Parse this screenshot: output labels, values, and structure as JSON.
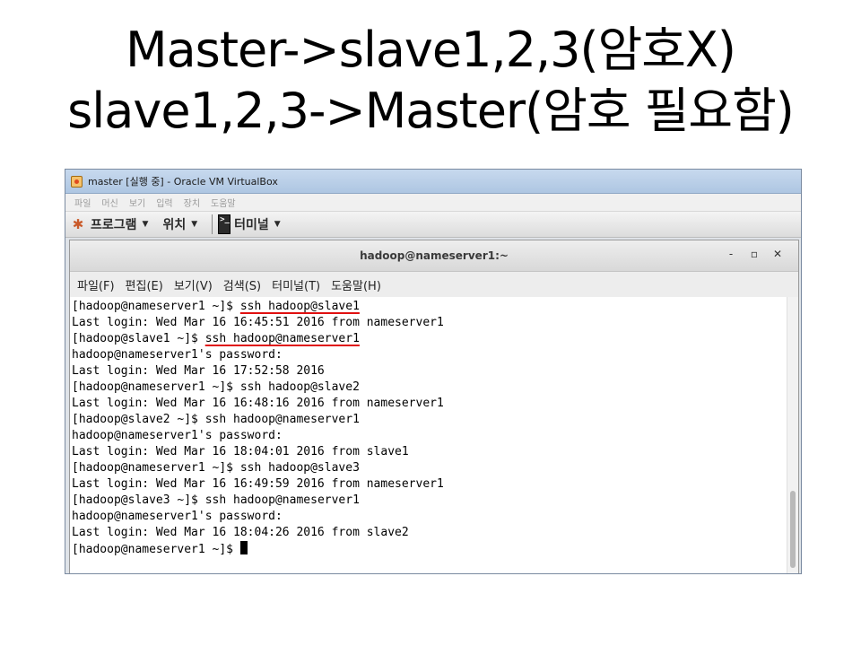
{
  "slide": {
    "title_line1": "Master->slave1,2,3(암호X)",
    "title_line2": "slave1,2,3->Master(암호 필요함)"
  },
  "vbox": {
    "window_title": "master [실행 중] - Oracle VM VirtualBox",
    "menu": [
      "파일",
      "머신",
      "보기",
      "입력",
      "장치",
      "도움말"
    ]
  },
  "guest_panel": {
    "applications": "프로그램",
    "places": "위치",
    "terminal": "터미널"
  },
  "terminal_window": {
    "title": "hadoop@nameserver1:~",
    "controls": {
      "minimize": "-",
      "maximize": "▫",
      "close": "✕"
    },
    "menu": [
      "파일(F)",
      "편집(E)",
      "보기(V)",
      "검색(S)",
      "터미널(T)",
      "도움말(H)"
    ],
    "lines": [
      {
        "prompt": "[hadoop@nameserver1 ~]$ ",
        "command": "ssh hadoop@slave1",
        "underlined": true
      },
      {
        "text": "Last login: Wed Mar 16 16:45:51 2016 from nameserver1"
      },
      {
        "prompt": "[hadoop@slave1 ~]$ ",
        "command": "ssh hadoop@nameserver1",
        "underlined": true
      },
      {
        "text": "hadoop@nameserver1's password:"
      },
      {
        "text": "Last login: Wed Mar 16 17:52:58 2016"
      },
      {
        "prompt": "[hadoop@nameserver1 ~]$ ",
        "command": "ssh hadoop@slave2"
      },
      {
        "text": "Last login: Wed Mar 16 16:48:16 2016 from nameserver1"
      },
      {
        "prompt": "[hadoop@slave2 ~]$ ",
        "command": "ssh hadoop@nameserver1"
      },
      {
        "text": "hadoop@nameserver1's password:"
      },
      {
        "text": "Last login: Wed Mar 16 18:04:01 2016 from slave1"
      },
      {
        "prompt": "[hadoop@nameserver1 ~]$ ",
        "command": "ssh hadoop@slave3"
      },
      {
        "text": "Last login: Wed Mar 16 16:49:59 2016 from nameserver1"
      },
      {
        "prompt": "[hadoop@slave3 ~]$ ",
        "command": "ssh hadoop@nameserver1"
      },
      {
        "text": "hadoop@nameserver1's password:"
      },
      {
        "text": "Last login: Wed Mar 16 18:04:26 2016 from slave2"
      },
      {
        "prompt": "[hadoop@nameserver1 ~]$ ",
        "command": "",
        "cursor": true
      }
    ],
    "highlight_color": "#e01010"
  }
}
